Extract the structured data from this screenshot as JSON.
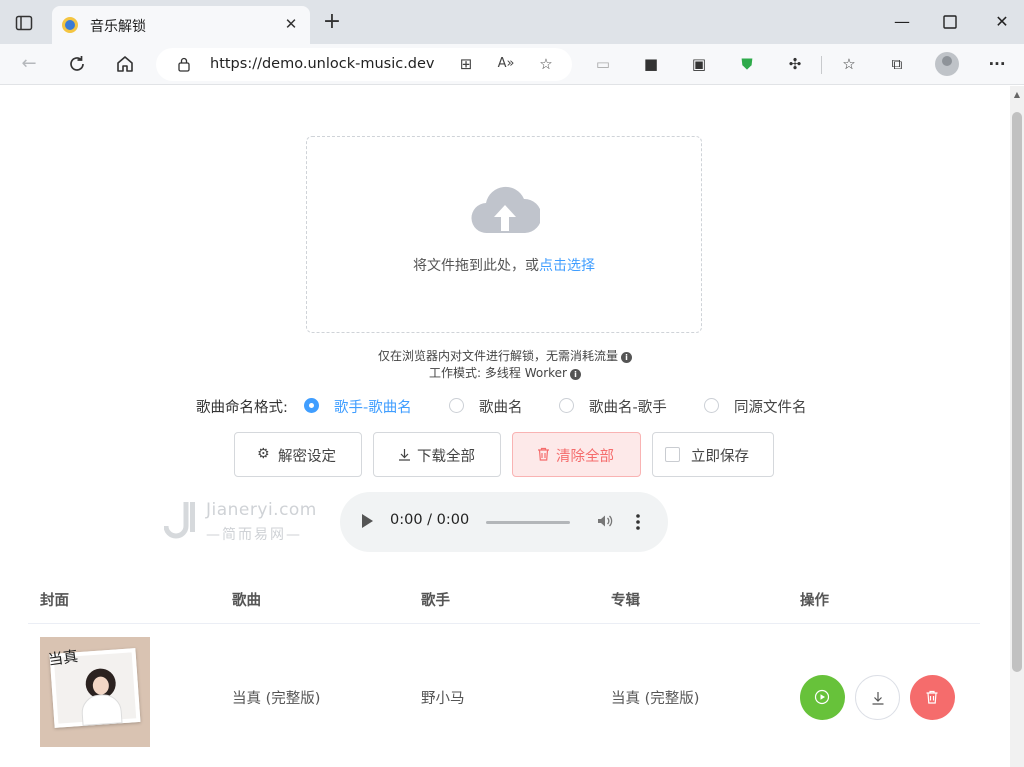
{
  "browser": {
    "tab_title": "音乐解锁",
    "url": "https://demo.unlock-music.dev"
  },
  "upload": {
    "prompt": "将文件拖到此处，或",
    "link": "点击选择",
    "tip_privacy": "仅在浏览器内对文件进行解锁，无需消耗流量",
    "tip_mode": "工作模式: 多线程 Worker"
  },
  "naming": {
    "label": "歌曲命名格式:",
    "options": [
      "歌手-歌曲名",
      "歌曲名",
      "歌曲名-歌手",
      "同源文件名"
    ],
    "selected": "歌手-歌曲名"
  },
  "actions": {
    "decrypt_settings": "解密设定",
    "download_all": "下载全部",
    "clear_all": "清除全部",
    "save_now": "立即保存"
  },
  "watermark": {
    "brand": "Jianeryi.com",
    "slogan": "—简而易网—"
  },
  "player": {
    "time": "0:00 / 0:00"
  },
  "table": {
    "headers": [
      "封面",
      "歌曲",
      "歌手",
      "专辑",
      "操作"
    ],
    "rows": [
      {
        "cover_title": "当真",
        "song": "当真 (完整版)",
        "artist": "野小马",
        "album": "当真 (完整版)"
      }
    ]
  },
  "colors": {
    "accent": "#409eff",
    "danger": "#f56c6c",
    "success": "#67c23a"
  }
}
